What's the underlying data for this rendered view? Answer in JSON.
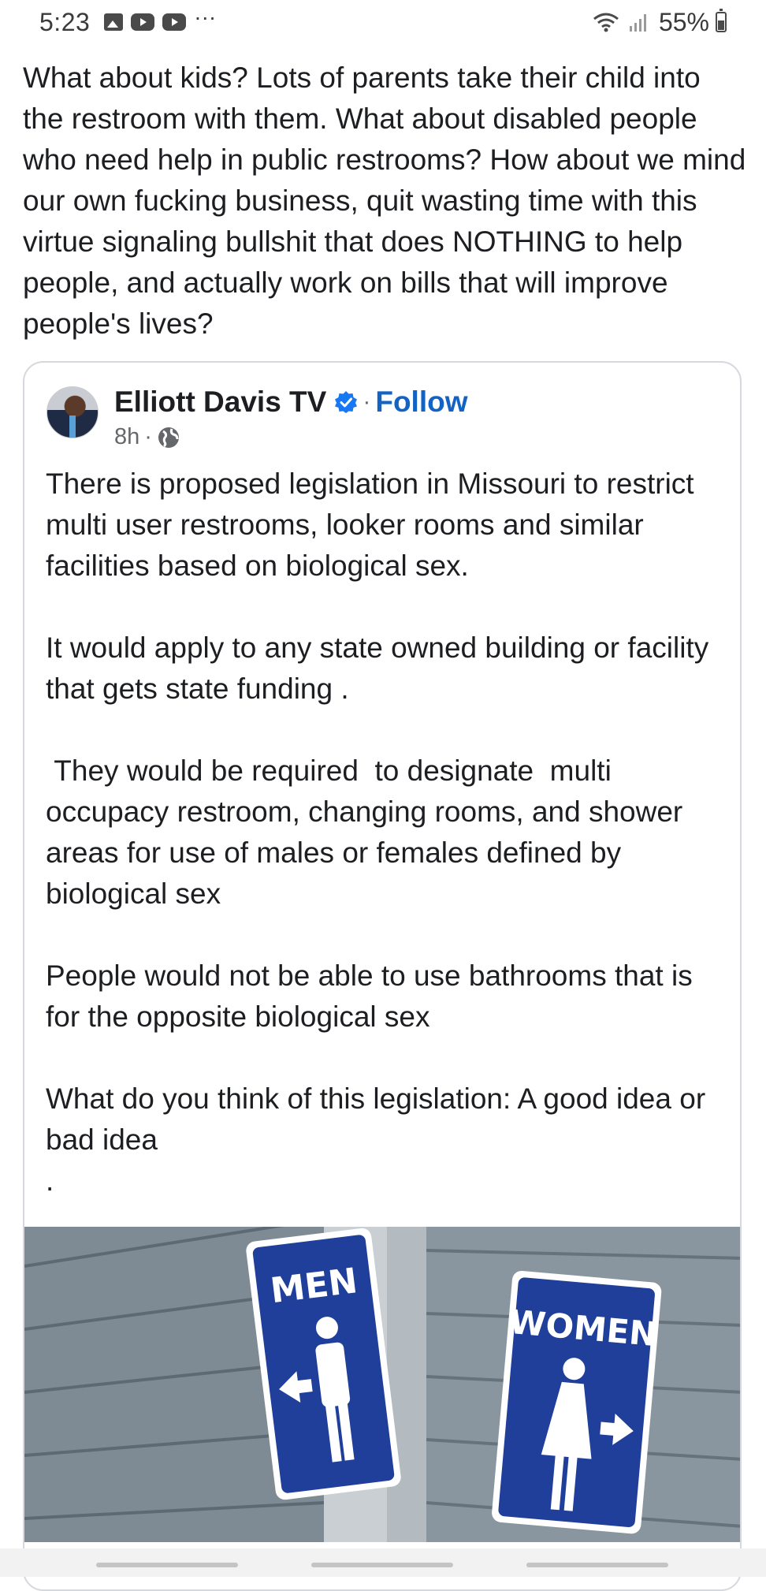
{
  "status_bar": {
    "time": "5:23",
    "left_icons": [
      "gallery-icon",
      "youtube-icon",
      "youtube-icon",
      "more-icon"
    ],
    "battery_percent": "55%"
  },
  "post": {
    "text": "What about kids?   Lots of parents take their child into the restroom with them.  What about disabled people who need help in public restrooms?  How about we mind our own fucking business, quit wasting time with this virtue signaling bullshit that does NOTHING to help people, and actually work on bills that will improve people's lives?"
  },
  "shared_post": {
    "author": "Elliott Davis TV",
    "separator": "·",
    "follow_label": "Follow",
    "timestamp": "8h",
    "meta_separator": "·",
    "body": "There is proposed legislation in Missouri to restrict multi user restrooms, looker rooms and similar facilities based on biological sex.\n\nIt would apply to any state owned building or facility that gets state funding .\n\n They would be required  to designate  multi occupacy restroom, changing rooms, and shower areas for use of males or females defined by biological sex\n\nPeople would not be able to use bathrooms that is for the opposite biological sex\n\nWhat do you think of this legislation: A good idea or bad idea\n.",
    "image": {
      "sign_left": "MEN",
      "sign_right": "WOMEN",
      "colors": {
        "sign_blue": "#1f3f9a",
        "siding": "#8a969f"
      }
    }
  },
  "colors": {
    "link_blue": "#1263c4",
    "text": "#1c1e21",
    "meta_gray": "#65676b"
  }
}
